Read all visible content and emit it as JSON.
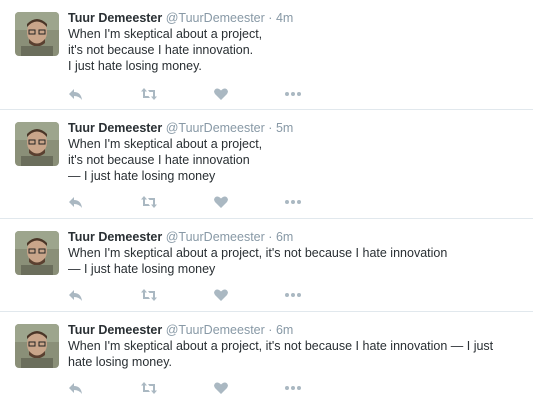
{
  "colors": {
    "text": "#292f33",
    "meta": "#8899a6",
    "action_icon": "#aab8c2",
    "divider": "#e1e8ed"
  },
  "tweets": [
    {
      "name": "Tuur Demeester",
      "handle": "@TuurDemeester",
      "separator": "·",
      "time": "4m",
      "text": "When I'm skeptical about a project,\nit's not because I hate innovation.\nI just hate losing money.",
      "actions": [
        "reply-icon",
        "retweet-icon",
        "like-icon",
        "more-icon"
      ]
    },
    {
      "name": "Tuur Demeester",
      "handle": "@TuurDemeester",
      "separator": "·",
      "time": "5m",
      "text": "When I'm skeptical about a project,\nit's not because I hate innovation\n— I just hate losing money",
      "actions": [
        "reply-icon",
        "retweet-icon",
        "like-icon",
        "more-icon"
      ]
    },
    {
      "name": "Tuur Demeester",
      "handle": "@TuurDemeester",
      "separator": "·",
      "time": "6m",
      "text": "When I'm skeptical about a project, it's not because I hate innovation\n— I just hate losing money",
      "actions": [
        "reply-icon",
        "retweet-icon",
        "like-icon",
        "more-icon"
      ]
    },
    {
      "name": "Tuur Demeester",
      "handle": "@TuurDemeester",
      "separator": "·",
      "time": "6m",
      "text": "When I'm skeptical about a project, it's not because I hate innovation — I just\nhate losing money.",
      "actions": [
        "reply-icon",
        "retweet-icon",
        "like-icon",
        "more-icon"
      ]
    }
  ]
}
